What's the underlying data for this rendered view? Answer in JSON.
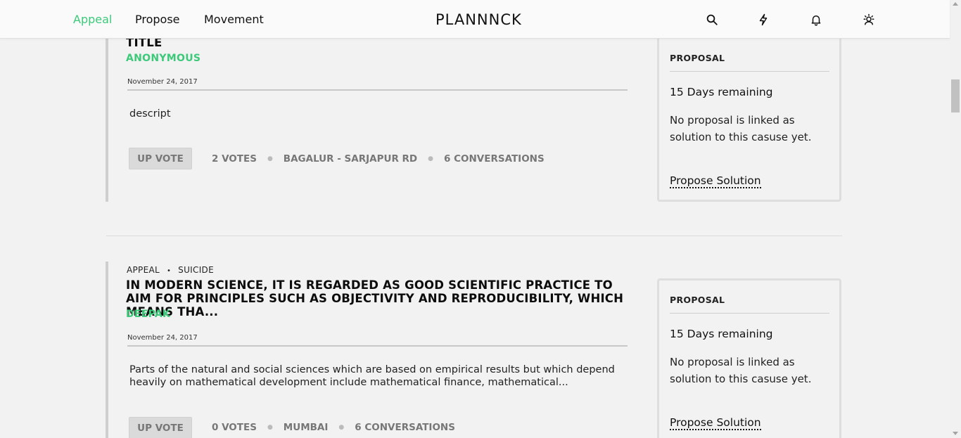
{
  "nav": {
    "links": [
      "Appeal",
      "Propose",
      "Movement"
    ],
    "logo": "PLANNNCK",
    "icons": [
      "search-icon",
      "lightning-icon",
      "bell-icon",
      "profile-icon"
    ],
    "accent_color": "#3cc97a"
  },
  "items": [
    {
      "category": "",
      "subcategory": "",
      "title": "TITLE",
      "author": "ANONYMOUS",
      "date": "November 24, 2017",
      "description": "descript",
      "upvote_label": "UP VOTE",
      "votes": "2 VOTES",
      "location": "BAGALUR - SARJAPUR RD",
      "conversations": "6 CONVERSATIONS",
      "card": {
        "label": "PROPOSAL",
        "days": "15 Days remaining",
        "text": "No proposal is linked as solution to this casuse yet.",
        "link": "Propose Solution"
      }
    },
    {
      "category": "APPEAL",
      "subcategory": "SUICIDE",
      "title": "IN MODERN SCIENCE, IT IS REGARDED AS GOOD SCIENTIFIC PRACTICE TO AIM FOR PRINCIPLES SUCH AS OBJECTIVITY AND REPRODUCIBILITY, WHICH MEANS THA...",
      "author": "DEEPAK",
      "date": "November 24, 2017",
      "description": "Parts of the natural and social sciences which are based on empirical results but which depend heavily on mathematical development include mathematical finance, mathematical...",
      "upvote_label": "UP VOTE",
      "votes": "0 VOTES",
      "location": "MUMBAI",
      "conversations": "6 CONVERSATIONS",
      "card": {
        "label": "PROPOSAL",
        "days": "15 Days remaining",
        "text": "No proposal is linked as solution to this casuse yet.",
        "link": "Propose Solution"
      }
    }
  ]
}
